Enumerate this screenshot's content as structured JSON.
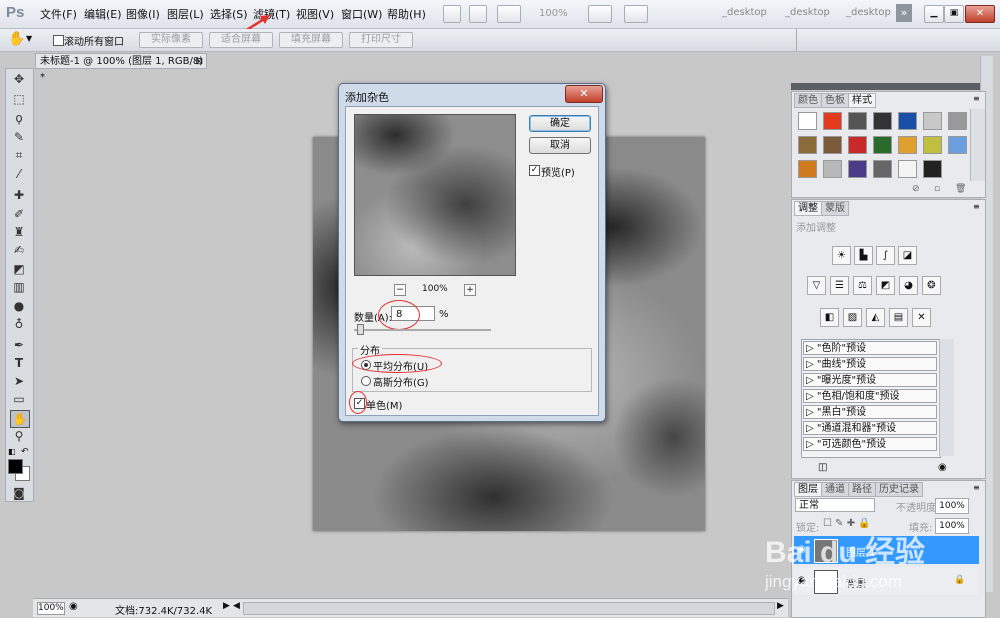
{
  "app": {
    "logo": "Ps",
    "menu": [
      "文件(F)",
      "编辑(E)",
      "图像(I)",
      "图层(L)",
      "选择(S)",
      "滤镜(T)",
      "视图(V)",
      "窗口(W)",
      "帮助(H)"
    ],
    "zoom_select": "100%",
    "workspaces": [
      "_desktop",
      "_desktop",
      "_desktop"
    ],
    "window_buttons": [
      "▁",
      "▣",
      "✕"
    ]
  },
  "options_bar": {
    "scroll_all_windows": "滚动所有窗口",
    "scroll_all_windows_checked": false,
    "buttons": [
      "实际像素",
      "适合屏幕",
      "填充屏幕",
      "打印尺寸"
    ]
  },
  "document": {
    "tab_title": "未标题-1 @ 100% (图层 1, RGB/8) *",
    "zoom": "100%",
    "doc_info": "文档:732.4K/732.4K"
  },
  "dialog": {
    "title": "添加杂色",
    "ok_label": "确定",
    "cancel_label": "取消",
    "preview_label": "预览(P)",
    "preview_checked": true,
    "preview_zoom": "100%",
    "zoom_out": "−",
    "zoom_in": "+",
    "amount_label": "数量(A):",
    "amount_value": "8",
    "amount_unit": "%",
    "amount_slider_fraction": 0.02,
    "distribution_label": "分布",
    "uniform_label": "平均分布(U)",
    "gaussian_label": "高斯分布(G)",
    "selected_distribution": "uniform",
    "mono_label": "单色(M)",
    "mono_checked": true,
    "close_glyph": "✕"
  },
  "panels": {
    "swatch_tabs": [
      "颜色",
      "色板",
      "样式"
    ],
    "adjust_tabs": [
      "调整",
      "蒙版"
    ],
    "adjust_title": "添加调整",
    "presets": [
      "\"色阶\"预设",
      "\"曲线\"预设",
      "\"曝光度\"预设",
      "\"色相/饱和度\"预设",
      "\"黑白\"预设",
      "\"通道混和器\"预设",
      "\"可选颜色\"预设"
    ],
    "layer_tabs": [
      "图层",
      "通道",
      "路径",
      "历史记录"
    ],
    "blend_mode": "正常",
    "opacity_label": "不透明度:",
    "opacity_value": "100%",
    "lock_label": "锁定:",
    "fill_label": "填充:",
    "fill_value": "100%",
    "layer_names": [
      "图层 1",
      "背景"
    ]
  },
  "watermark": {
    "text": "Bai du 经验",
    "url": "jingyan.baidu.com"
  },
  "colors": {
    "style_swatches": [
      "#ffffff",
      "#e23a1d",
      "#555555",
      "#333333",
      "#1a4fa8",
      "#c8c8c8",
      "#999999",
      "#8b6b3a",
      "#7a5a3a",
      "#c82a2a",
      "#2a6a2a",
      "#e0a030",
      "#c0c040",
      "#6aa0e0",
      "#d07a20",
      "#b8b8b8",
      "#4a3a8a",
      "#666666",
      "#f4f4f4",
      "#222222"
    ],
    "selection_blue": "#3399ff"
  }
}
